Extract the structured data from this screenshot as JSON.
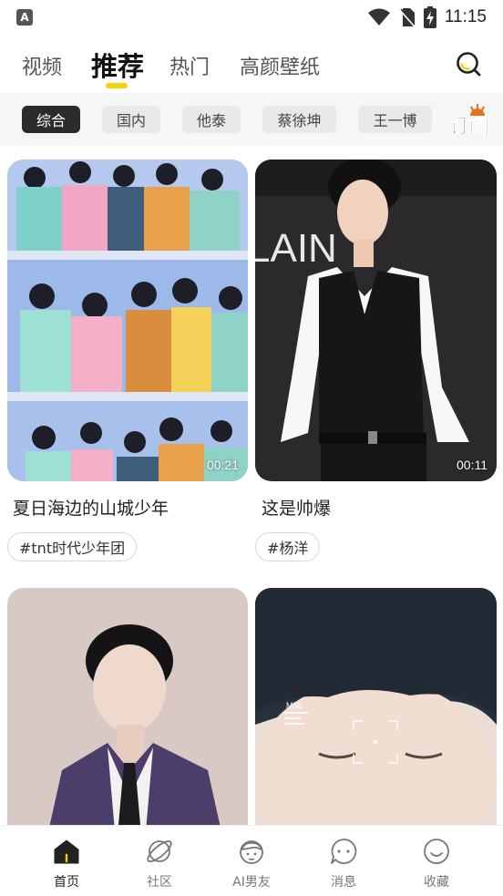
{
  "status_bar": {
    "time": "11:15",
    "app_icon_letter": "A"
  },
  "top_tabs": [
    {
      "label": "视频",
      "active": false
    },
    {
      "label": "推荐",
      "active": true
    },
    {
      "label": "热门",
      "active": false
    },
    {
      "label": "高颜壁纸",
      "active": false
    }
  ],
  "categories": [
    {
      "label": "综合",
      "active": true
    },
    {
      "label": "国内",
      "active": false
    },
    {
      "label": "他泰",
      "active": false
    },
    {
      "label": "蔡徐坤",
      "active": false
    },
    {
      "label": "王一博",
      "active": false
    }
  ],
  "subscribe_label": "订阅",
  "feed": [
    {
      "title": "夏日海边的山城少年",
      "tag": "#tnt时代少年团",
      "duration": "00:21"
    },
    {
      "title": "这是帅爆",
      "tag": "#杨洋",
      "duration": "00:11",
      "sign_text": "LAIN"
    },
    {
      "title": "",
      "tag": "",
      "duration": ""
    },
    {
      "title": "",
      "tag": "",
      "duration": "",
      "hud_text": "MNL"
    }
  ],
  "bottom_nav": [
    {
      "label": "首页",
      "icon": "home-icon",
      "active": true
    },
    {
      "label": "社区",
      "icon": "planet-icon",
      "active": false
    },
    {
      "label": "AI男友",
      "icon": "boyfriend-face-icon",
      "active": false
    },
    {
      "label": "消息",
      "icon": "message-bubble-icon",
      "active": false
    },
    {
      "label": "收藏",
      "icon": "smile-icon",
      "active": false
    }
  ],
  "colors": {
    "accent": "#f6cf10",
    "chip_active": "#2b2b2b",
    "chip_bg": "#e9e9e9"
  }
}
